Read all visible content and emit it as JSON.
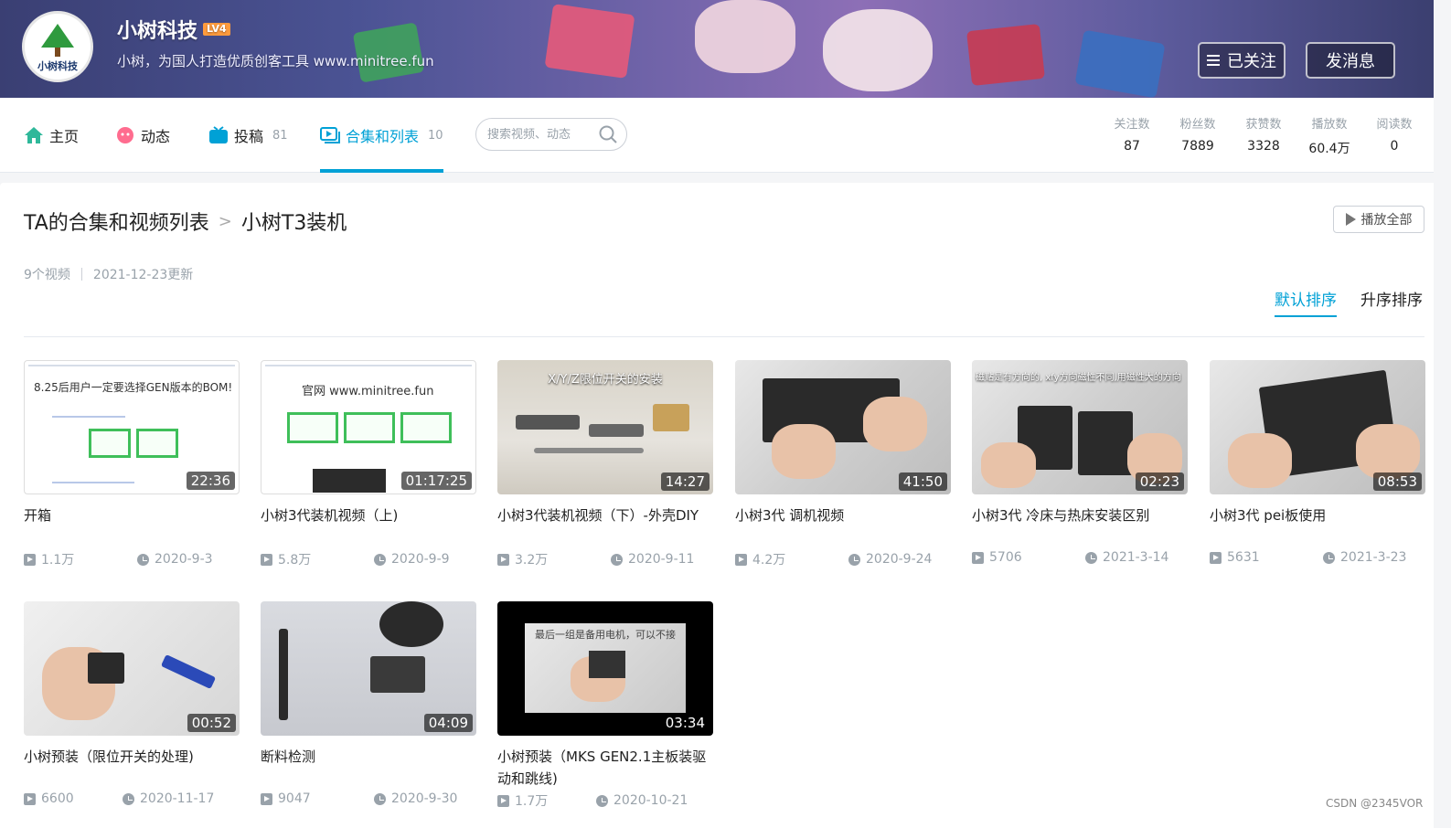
{
  "header": {
    "username": "小树科技",
    "level": "LV4",
    "avatar_text": "小树科技",
    "sign": "小树，为国人打造优质创客工具 www.minitree.fun",
    "follow_label": "已关注",
    "message_label": "发消息"
  },
  "nav": {
    "home": "主页",
    "dynamic": "动态",
    "submit": "投稿",
    "submit_count": "81",
    "collections": "合集和列表",
    "collections_count": "10",
    "search_placeholder": "搜索视频、动态"
  },
  "stats": [
    {
      "label": "关注数",
      "value": "87"
    },
    {
      "label": "粉丝数",
      "value": "7889"
    },
    {
      "label": "获赞数",
      "value": "3328"
    },
    {
      "label": "播放数",
      "value": "60.4万"
    },
    {
      "label": "阅读数",
      "value": "0"
    }
  ],
  "collection": {
    "parent": "TA的合集和视频列表",
    "title": "小树T3装机",
    "video_count": "9个视频",
    "updated": "2021-12-23更新",
    "play_all": "播放全部",
    "sort_default": "默认排序",
    "sort_asc": "升序排序"
  },
  "videos": [
    {
      "title": "开箱",
      "duration": "22:36",
      "plays": "1.1万",
      "date": "2020-9-3",
      "overlay": "8.25后用户一定要选择GEN版本的BOM!"
    },
    {
      "title": "小树3代装机视频（上)",
      "duration": "01:17:25",
      "plays": "5.8万",
      "date": "2020-9-9",
      "overlay": "官网  www.minitree.fun"
    },
    {
      "title": "小树3代装机视频（下）-外壳DIY",
      "duration": "14:27",
      "plays": "3.2万",
      "date": "2020-9-11",
      "overlay": "X/Y/Z限位开关的安装"
    },
    {
      "title": "小树3代 调机视频",
      "duration": "41:50",
      "plays": "4.2万",
      "date": "2020-9-24",
      "overlay": ""
    },
    {
      "title": "小树3代 冷床与热床安装区别",
      "duration": "02:23",
      "plays": "5706",
      "date": "2021-3-14",
      "overlay": "磁贴是有方向的, xfy方向磁性不同,用磁性大的方向"
    },
    {
      "title": "小树3代 pei板使用",
      "duration": "08:53",
      "plays": "5631",
      "date": "2021-3-23",
      "overlay": ""
    },
    {
      "title": "小树预装（限位开关的处理)",
      "duration": "00:52",
      "plays": "6600",
      "date": "2020-11-17",
      "overlay": ""
    },
    {
      "title": "断料检测",
      "duration": "04:09",
      "plays": "9047",
      "date": "2020-9-30",
      "overlay": ""
    },
    {
      "title": "小树预装（MKS GEN2.1主板装驱动和跳线)",
      "duration": "03:34",
      "plays": "1.7万",
      "date": "2020-10-21",
      "overlay": "最后一组是备用电机，可以不接"
    }
  ],
  "watermark": "CSDN @2345VOR",
  "colors": {
    "accent": "#00a1d6",
    "muted": "#99a2aa",
    "green": "#3fbf5a"
  }
}
